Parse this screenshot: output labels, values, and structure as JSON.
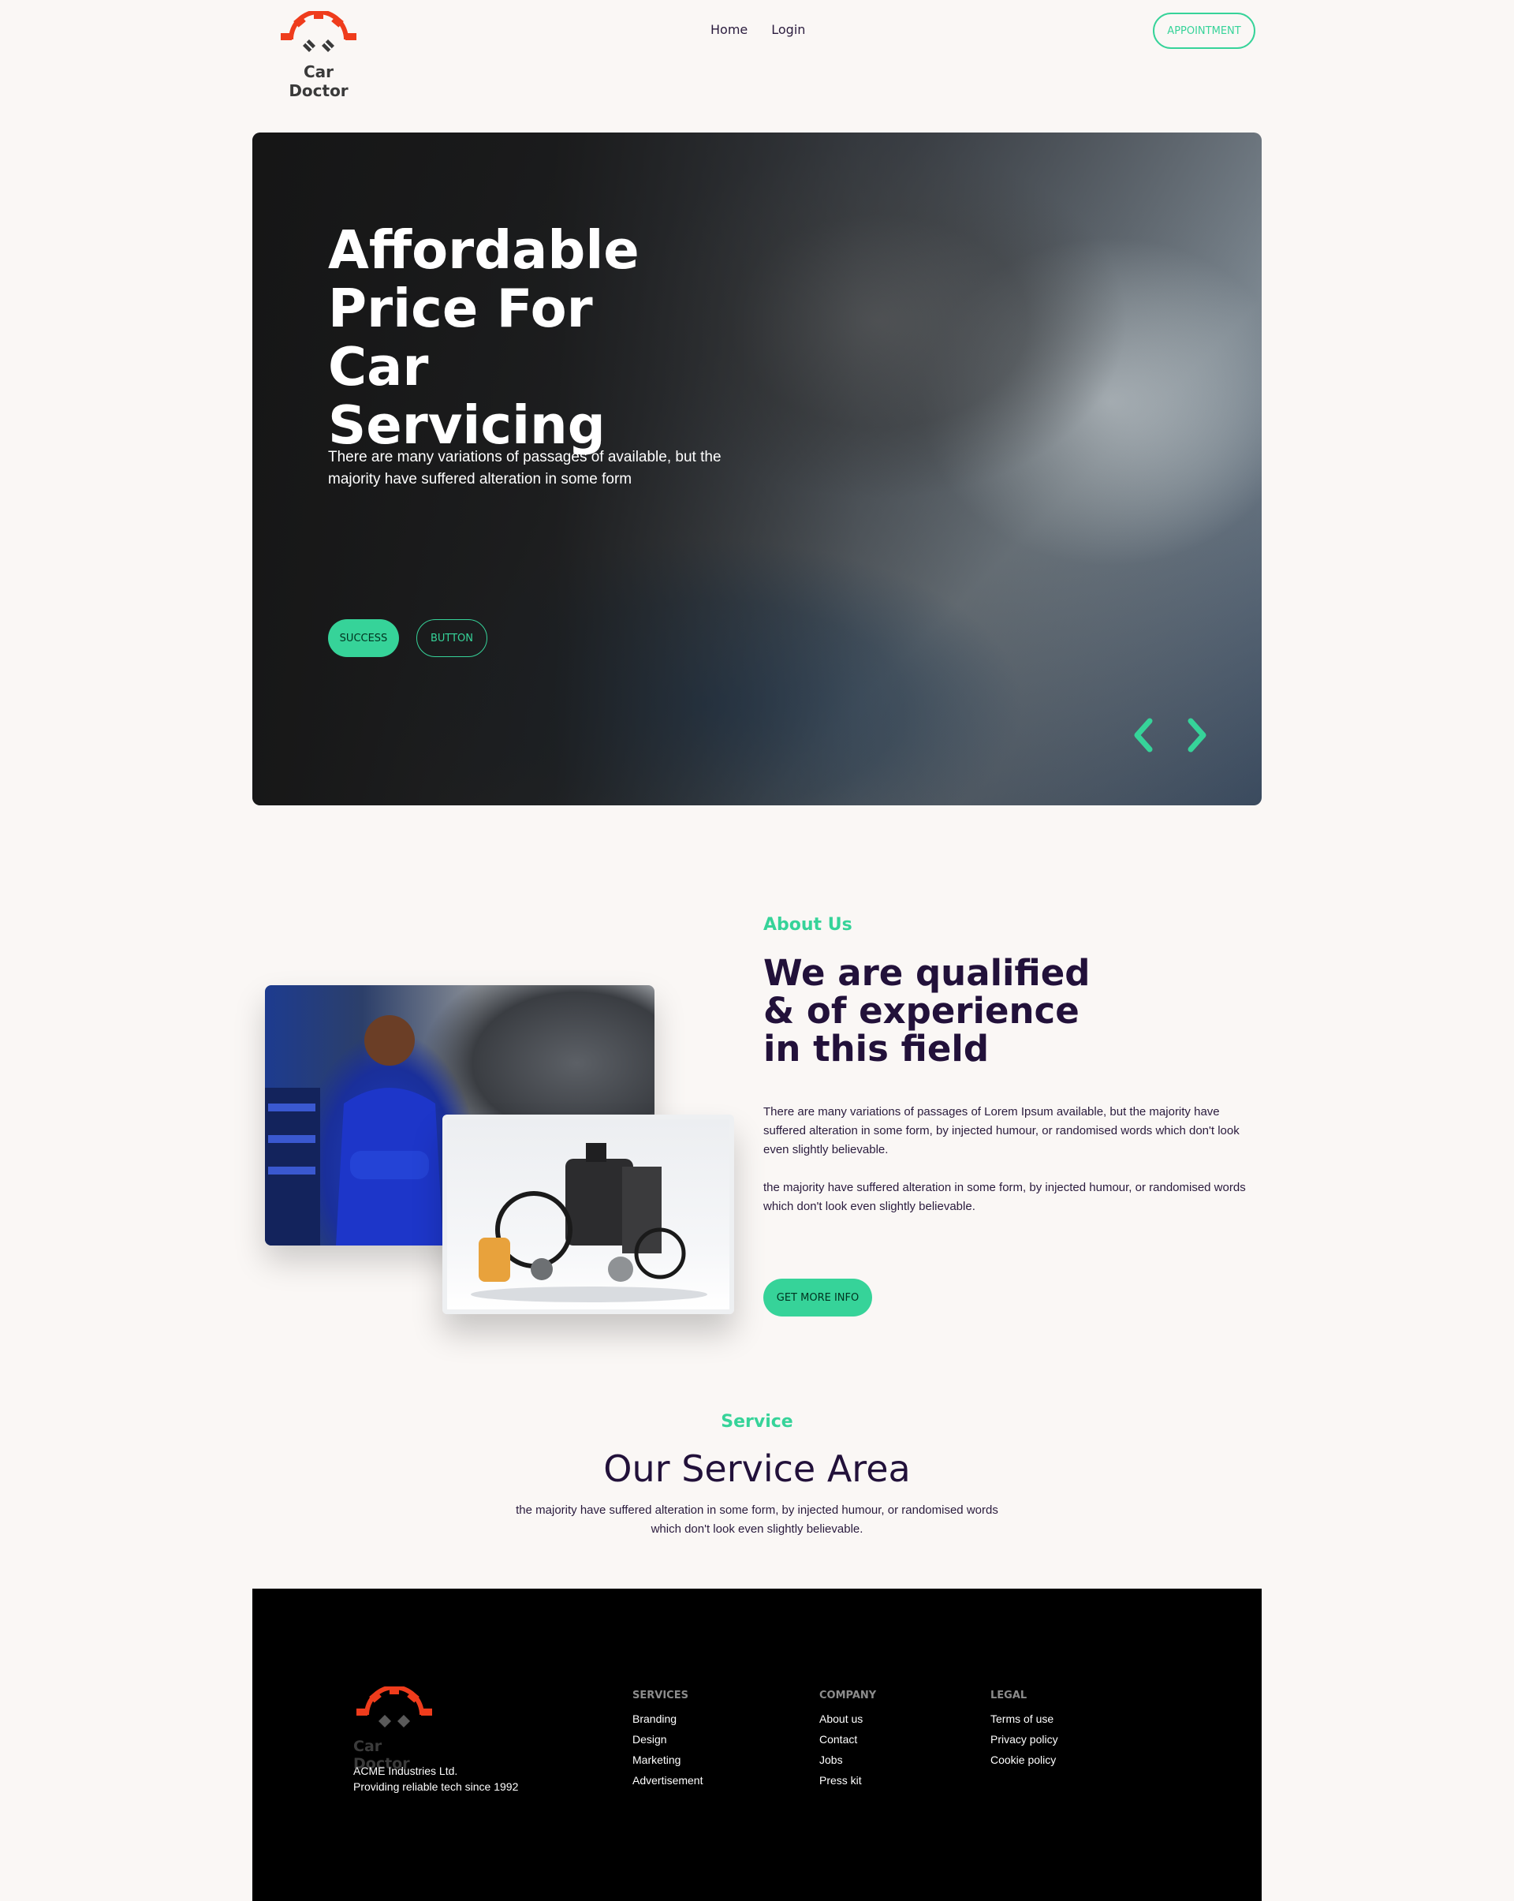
{
  "brand": {
    "name": "Car Doctor",
    "accent": "#36d399",
    "logo_color": "#ef3c1c"
  },
  "nav": {
    "items": [
      {
        "label": "Home"
      },
      {
        "label": "Login"
      }
    ],
    "appointment_label": "APPOINTMENT"
  },
  "hero": {
    "title": "Affordable Price For Car Servicing",
    "text": "There are many variations of passages of available, but the majority have suffered alteration in some form",
    "primary_btn": "SUCCESS",
    "secondary_btn": "BUTTON",
    "prev_icon": "chevron-left-icon",
    "next_icon": "chevron-right-icon"
  },
  "about": {
    "label": "About Us",
    "title": "We are qualified & of experience in this field",
    "paragraph1": "There are many variations of passages of Lorem Ipsum available, but the majority have suffered alteration in some form, by injected humour, or randomised words which don't look even slightly believable.",
    "paragraph2": "the majority have suffered alteration in some form, by injected humour, or randomised words which don't look even slightly believable.",
    "button": "GET MORE INFO"
  },
  "service": {
    "label": "Service",
    "title": "Our Service Area",
    "text": "the majority have suffered alteration in some form, by injected humour, or randomised words which don't look even slightly believable."
  },
  "footer": {
    "brand": "Car Doctor",
    "company_line1": "ACME Industries Ltd.",
    "company_line2": "Providing reliable tech since 1992",
    "columns": [
      {
        "title": "SERVICES",
        "links": [
          "Branding",
          "Design",
          "Marketing",
          "Advertisement"
        ]
      },
      {
        "title": "COMPANY",
        "links": [
          "About us",
          "Contact",
          "Jobs",
          "Press kit"
        ]
      },
      {
        "title": "LEGAL",
        "links": [
          "Terms of use",
          "Privacy policy",
          "Cookie policy"
        ]
      }
    ]
  }
}
